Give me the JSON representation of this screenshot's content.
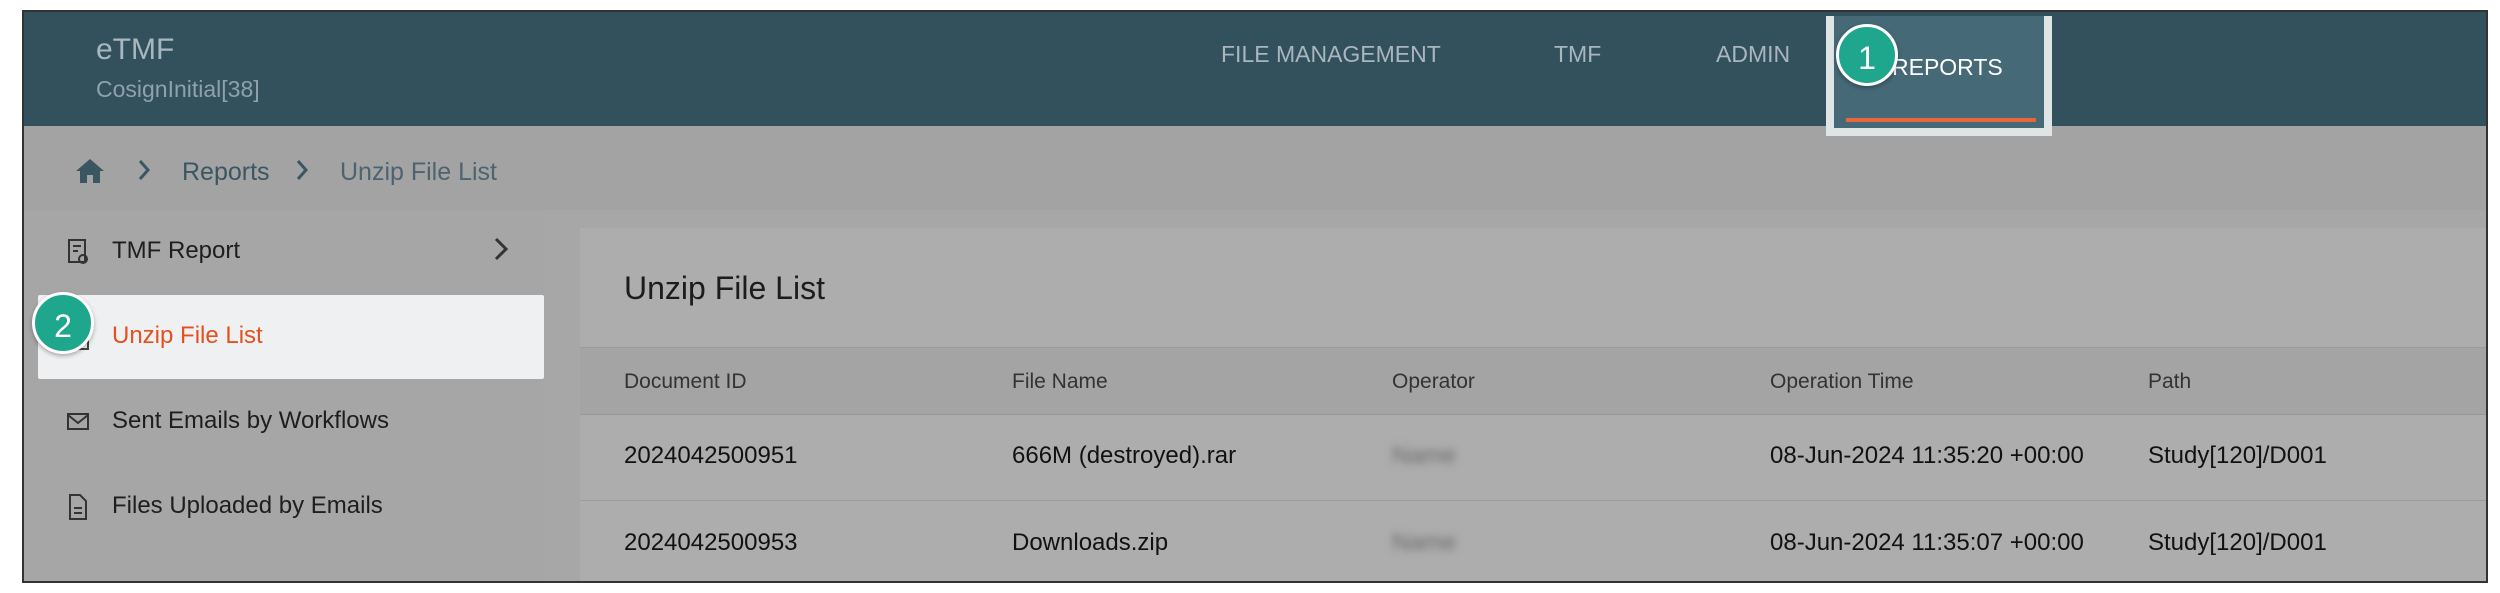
{
  "header": {
    "app_title": "eTMF",
    "subtitle": "CosignInitial[38]",
    "nav": {
      "file_management": "FILE MANAGEMENT",
      "tmf": "TMF",
      "admin": "ADMIN",
      "reports": "REPORTS"
    },
    "badge_1": "1"
  },
  "breadcrumb": {
    "home_icon": "home-icon",
    "items": [
      "Reports",
      "Unzip File List"
    ]
  },
  "sidebar": {
    "badge_2": "2",
    "items": [
      {
        "label": "TMF Report",
        "icon": "report-icon"
      },
      {
        "label": "Unzip File List",
        "icon": "file-icon"
      },
      {
        "label": "Sent Emails by Workflows",
        "icon": "mail-icon"
      },
      {
        "label": "Files Uploaded by Emails",
        "icon": "document-icon"
      }
    ]
  },
  "main": {
    "title": "Unzip File List",
    "columns": [
      "Document ID",
      "File Name",
      "Operator",
      "Operation Time",
      "Path"
    ],
    "rows": [
      {
        "document_id": "2024042500951",
        "file_name": "666M (destroyed).rar",
        "operator": "Name",
        "operation_time": "08-Jun-2024 11:35:20 +00:00",
        "path": "Study[120]/D001"
      },
      {
        "document_id": "2024042500953",
        "file_name": "Downloads.zip",
        "operator": "Name",
        "operation_time": "08-Jun-2024 11:35:07 +00:00",
        "path": "Study[120]/D001"
      }
    ]
  },
  "colors": {
    "header_bg": "#33505d",
    "accent": "#e6501f",
    "badge": "#1fa78e"
  }
}
